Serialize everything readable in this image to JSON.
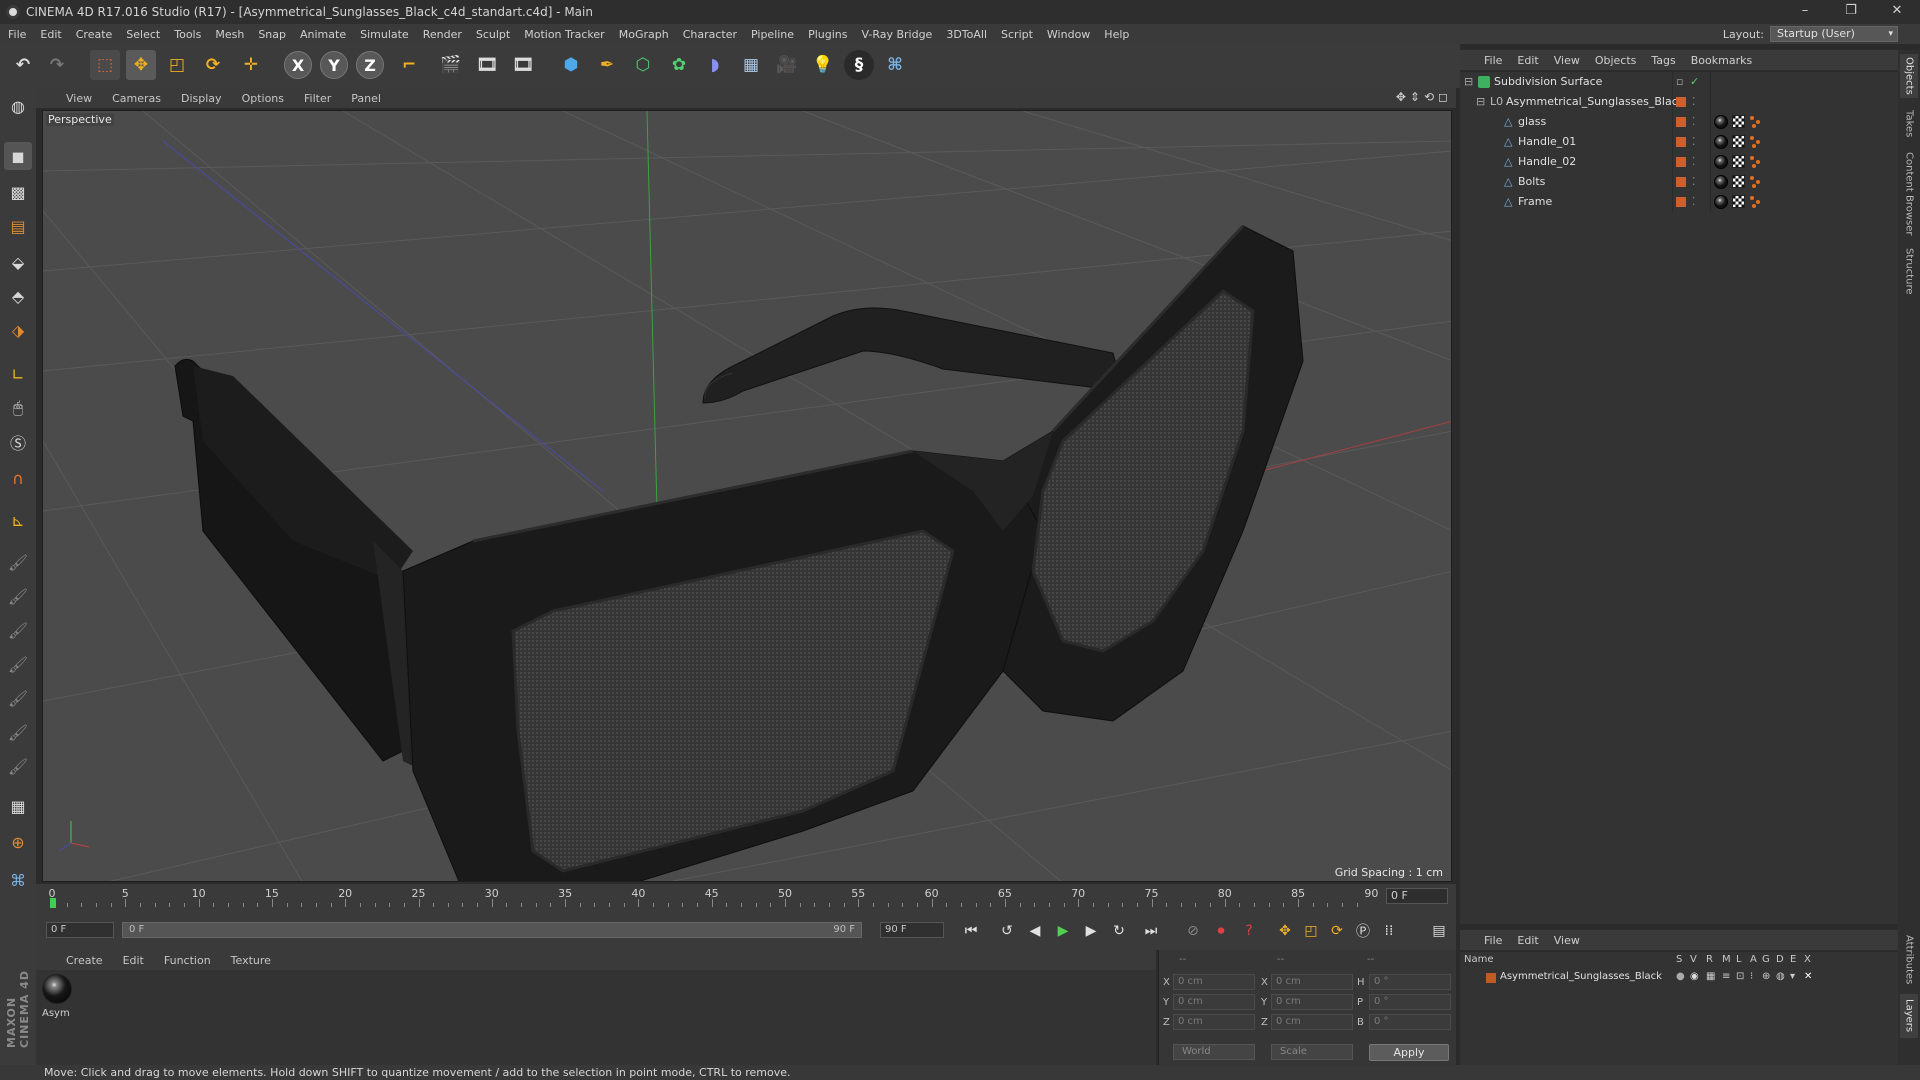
{
  "window": {
    "title": "CINEMA 4D R17.016 Studio (R17) - [Asymmetrical_Sunglasses_Black_c4d_standart.c4d] - Main",
    "controls": [
      "–",
      "❐",
      "✕"
    ]
  },
  "menubar": {
    "items": [
      "File",
      "Edit",
      "Create",
      "Select",
      "Tools",
      "Mesh",
      "Snap",
      "Animate",
      "Simulate",
      "Render",
      "Sculpt",
      "Motion Tracker",
      "MoGraph",
      "Character",
      "Pipeline",
      "Plugins",
      "V-Ray Bridge",
      "3DToAll",
      "Script",
      "Window",
      "Help"
    ],
    "layout_label": "Layout:",
    "layout_value": "Startup (User)"
  },
  "toolbar": {
    "axis_x": "X",
    "axis_y": "Y",
    "axis_z": "Z"
  },
  "viewport": {
    "menu": [
      "View",
      "Cameras",
      "Display",
      "Options",
      "Filter",
      "Panel"
    ],
    "camera_label": "Perspective",
    "grid_spacing": "Grid Spacing : 1 cm"
  },
  "timeline": {
    "ticks": [
      "0",
      "5",
      "10",
      "15",
      "20",
      "25",
      "30",
      "35",
      "40",
      "45",
      "50",
      "55",
      "60",
      "65",
      "70",
      "75",
      "80",
      "85",
      "90"
    ],
    "current_frame": "0 F",
    "start_field": "0 F",
    "range_start": "0 F",
    "range_end": "90 F",
    "end_field": "90 F"
  },
  "material_manager": {
    "menu": [
      "Create",
      "Edit",
      "Function",
      "Texture"
    ],
    "material_name": "Asym"
  },
  "coordinates": {
    "header": [
      "--",
      "--",
      "--"
    ],
    "rows": [
      {
        "axis": "X",
        "pos": "0 cm",
        "axis2": "X",
        "size": "0 cm",
        "rot_label": "H",
        "rot": "0 °"
      },
      {
        "axis": "Y",
        "pos": "0 cm",
        "axis2": "Y",
        "size": "0 cm",
        "rot_label": "P",
        "rot": "0 °"
      },
      {
        "axis": "Z",
        "pos": "0 cm",
        "axis2": "Z",
        "size": "0 cm",
        "rot_label": "B",
        "rot": "0 °"
      }
    ],
    "mode_world": "World",
    "mode_scale": "Scale",
    "apply": "Apply"
  },
  "status_bar": {
    "text": "Move: Click and drag to move elements. Hold down SHIFT to quantize movement / add to the selection in point mode, CTRL to remove."
  },
  "object_manager": {
    "menu": [
      "File",
      "Edit",
      "View",
      "Objects",
      "Tags",
      "Bookmarks"
    ],
    "objects": [
      {
        "name": "Subdivision Surface",
        "type": "subdivision"
      },
      {
        "name": "Asymmetrical_Sunglasses_Black",
        "type": "null"
      },
      {
        "name": "glass",
        "type": "polygon"
      },
      {
        "name": "Handle_01",
        "type": "polygon"
      },
      {
        "name": "Handle_02",
        "type": "polygon"
      },
      {
        "name": "Bolts",
        "type": "polygon"
      },
      {
        "name": "Frame",
        "type": "polygon"
      }
    ]
  },
  "layer_manager": {
    "menu": [
      "File",
      "Edit",
      "View"
    ],
    "columns": [
      "Name",
      "S",
      "V",
      "R",
      "M",
      "L",
      "A",
      "G",
      "D",
      "E",
      "X"
    ],
    "layers": [
      {
        "name": "Asymmetrical_Sunglasses_Black"
      }
    ]
  },
  "side_tabs": [
    "Objects",
    "Takes",
    "Content Browser",
    "Structure",
    "Attributes",
    "Layers"
  ],
  "colors": {
    "accent_orange": "#d0602a",
    "layer_color": "#c25a24",
    "viewport_bg": "#4b4b4b"
  }
}
